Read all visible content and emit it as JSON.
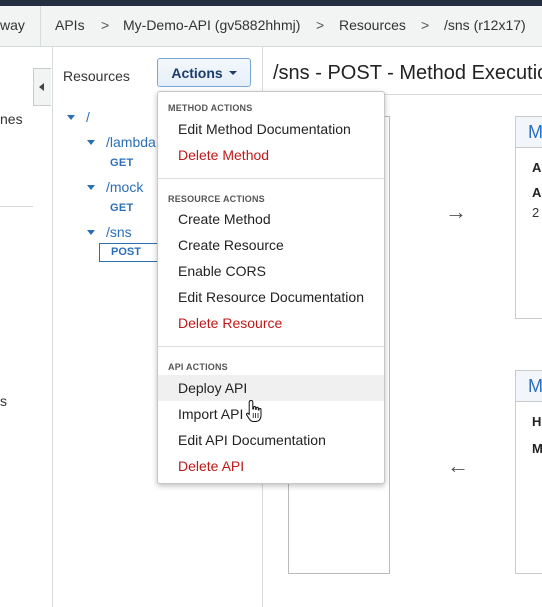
{
  "breadcrumb": {
    "items": [
      "way",
      "APIs",
      "My-Demo-API (gv5882hhmj)",
      "Resources",
      "/sns (r12x17)"
    ],
    "separator": ">"
  },
  "left_nav": {
    "fragment_1": "nes",
    "fragment_2": "s"
  },
  "resources_panel": {
    "heading": "Resources",
    "actions_label": "Actions",
    "tree": {
      "root": "/",
      "children": [
        {
          "path": "/lambda",
          "methods": [
            "GET"
          ]
        },
        {
          "path": "/mock",
          "methods": [
            "GET"
          ]
        },
        {
          "path": "/sns",
          "methods": [
            "POST"
          ]
        }
      ]
    }
  },
  "main": {
    "title": "/sns - POST - Method Execution",
    "card_top": {
      "header": "M",
      "line_1": "A",
      "line_2": "A",
      "value": "2"
    },
    "card_bottom": {
      "header": "M",
      "line_1": "H",
      "line_2": "M"
    },
    "arrow_right": "→",
    "arrow_left": "←"
  },
  "actions_menu": {
    "sections": [
      {
        "header": "METHOD ACTIONS",
        "items": [
          {
            "label": "Edit Method Documentation",
            "danger": false
          },
          {
            "label": "Delete Method",
            "danger": true
          }
        ]
      },
      {
        "header": "RESOURCE ACTIONS",
        "items": [
          {
            "label": "Create Method",
            "danger": false
          },
          {
            "label": "Create Resource",
            "danger": false
          },
          {
            "label": "Enable CORS",
            "danger": false
          },
          {
            "label": "Edit Resource Documentation",
            "danger": false
          },
          {
            "label": "Delete Resource",
            "danger": true
          }
        ]
      },
      {
        "header": "API ACTIONS",
        "items": [
          {
            "label": "Deploy API",
            "danger": false
          },
          {
            "label": "Import API",
            "danger": false
          },
          {
            "label": "Edit API Documentation",
            "danger": false
          },
          {
            "label": "Delete API",
            "danger": true
          }
        ]
      }
    ],
    "hovered_item": "Deploy API"
  },
  "colors": {
    "accent": "#2b6fb8",
    "danger": "#c01818",
    "header_bar": "#232f3e"
  }
}
